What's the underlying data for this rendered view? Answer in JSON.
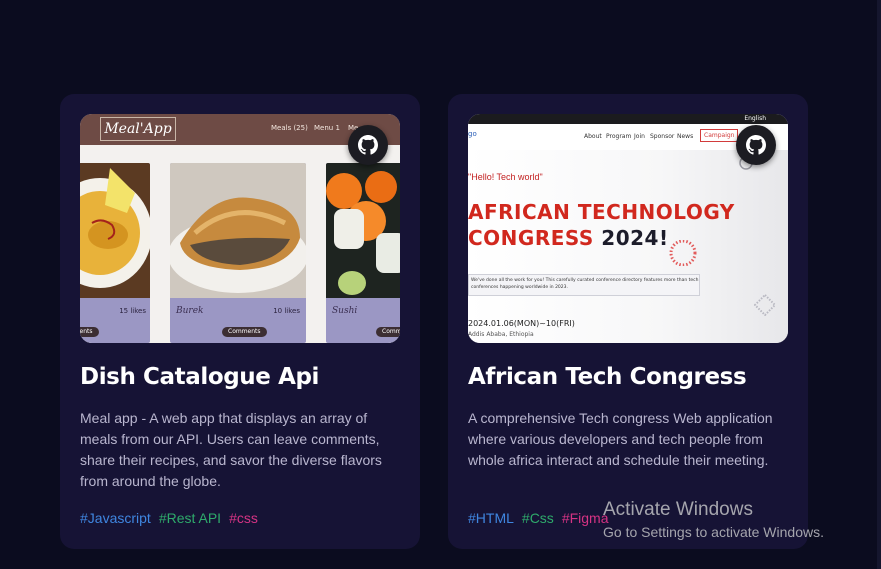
{
  "colors": {
    "page_bg": "#0b0c1f",
    "card_bg": "#161335",
    "tag_blue": "#3f86e0",
    "tag_green": "#2eaa6b",
    "tag_pink": "#d63384"
  },
  "cards": [
    {
      "title": "Dish Catalogue Api",
      "description": "Meal app - A web app that displays an array of meals from our API. Users can leave comments, share their recipes, and savor the diverse flavors from around the globe.",
      "tags": [
        "#Javascript",
        "#Rest API",
        "#css"
      ],
      "github_icon": "github-icon",
      "screenshot": {
        "logo": "Meal'App",
        "nav": [
          "Meals (25)",
          "Menu 1",
          "Me"
        ],
        "meals": [
          {
            "name": "",
            "likes": "15 likes",
            "button": "Comments"
          },
          {
            "name": "Burek",
            "likes": "10 likes",
            "button": "Comments"
          },
          {
            "name": "Sushi",
            "likes": "",
            "button": "Comm"
          }
        ]
      }
    },
    {
      "title": "African Tech Congress",
      "description": "A comprehensive Tech congress Web application where various developers and tech people from whole africa interact and schedule their meeting.",
      "tags": [
        "#HTML",
        "#Css",
        "#Figma"
      ],
      "github_icon": "github-icon",
      "screenshot": {
        "topbar": "English",
        "brand": "go",
        "nav": [
          "About",
          "Program",
          "Join",
          "Sponsor",
          "News",
          "Campaign"
        ],
        "hello": "\"Hello! Tech world\"",
        "headline_1": "AFRICAN TECHNOLOGY",
        "headline_2_a": "CONGRESS",
        "headline_2_b": "2024!",
        "note": "We've done all the work for you! This carefully curated conference directory features more than tech conferences happening worldwide in 2023.",
        "date": "2024.01.06(MON)~10(FRI)",
        "location": "Addis Ababa, Ethiopia"
      }
    }
  ],
  "watermark": {
    "line1": "Activate Windows",
    "line2": "Go to Settings to activate Windows."
  }
}
